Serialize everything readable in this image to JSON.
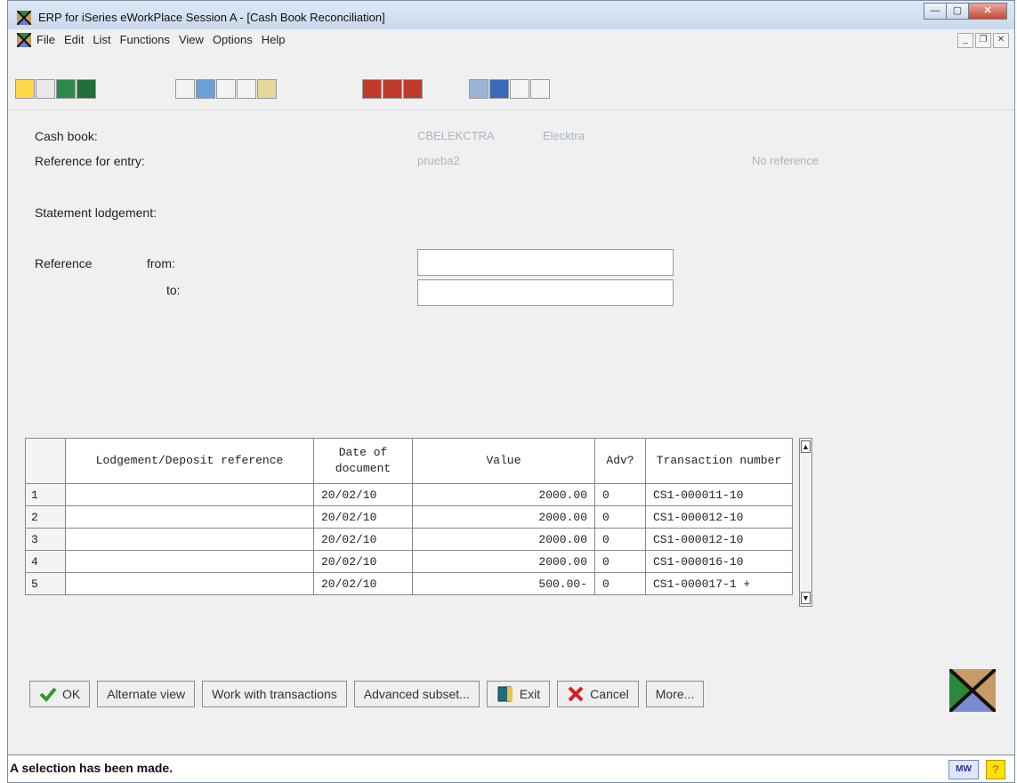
{
  "window": {
    "title": "ERP for iSeries eWorkPlace Session A - [Cash Book Reconciliation]"
  },
  "menu": [
    "File",
    "Edit",
    "List",
    "Functions",
    "View",
    "Options",
    "Help"
  ],
  "toolbar_groups": [
    [
      "key-icon",
      "new-doc-icon",
      "calculator-icon",
      "spreadsheet-icon"
    ],
    [
      "undo-icon",
      "grid-icon",
      "cut-icon",
      "copy-icon",
      "paste-icon"
    ],
    [
      "find-1-icon",
      "find-2-icon",
      "find-3-icon"
    ],
    [
      "window-icon",
      "table-icon",
      "hand-icon",
      "help-icon"
    ]
  ],
  "form": {
    "cash_book_label": "Cash book:",
    "cash_book_code": "CBELEKCTRA",
    "cash_book_name": "Elecktra",
    "reference_entry_label": "Reference for entry:",
    "reference_entry_value": "prueba2",
    "reference_entry_status": "No reference",
    "statement_lodgement_label": "Statement lodgement:",
    "reference_label": "Reference",
    "from_label": "from:",
    "to_label": "to:",
    "from_value": "",
    "to_value": ""
  },
  "grid": {
    "headers": [
      "Lodgement/Deposit reference",
      "Date of document",
      "Value",
      "Adv?",
      "Transaction number"
    ],
    "rows": [
      {
        "n": "1",
        "ref": "",
        "date": "20/02/10",
        "value": "2000.00",
        "adv": "0",
        "txn": "CS1-000011-10"
      },
      {
        "n": "2",
        "ref": "",
        "date": "20/02/10",
        "value": "2000.00",
        "adv": "0",
        "txn": "CS1-000012-10"
      },
      {
        "n": "3",
        "ref": "",
        "date": "20/02/10",
        "value": "2000.00",
        "adv": "0",
        "txn": "CS1-000012-10"
      },
      {
        "n": "4",
        "ref": "",
        "date": "20/02/10",
        "value": "2000.00",
        "adv": "0",
        "txn": "CS1-000016-10"
      },
      {
        "n": "5",
        "ref": "",
        "date": "20/02/10",
        "value": "500.00-",
        "adv": "0",
        "txn": "CS1-000017-1 +"
      }
    ]
  },
  "buttons": {
    "ok": "OK",
    "alternate_view": "Alternate view",
    "work_with_transactions": "Work with transactions",
    "advanced_subset": "Advanced subset...",
    "exit": "Exit",
    "cancel": "Cancel",
    "more": "More..."
  },
  "status": {
    "message": "A selection has been made.",
    "mw": "MW",
    "help": "?"
  },
  "colors": {
    "accent_green": "#2e9a2e",
    "cancel_red": "#d42020",
    "disabled_text": "#a8b6c6"
  }
}
